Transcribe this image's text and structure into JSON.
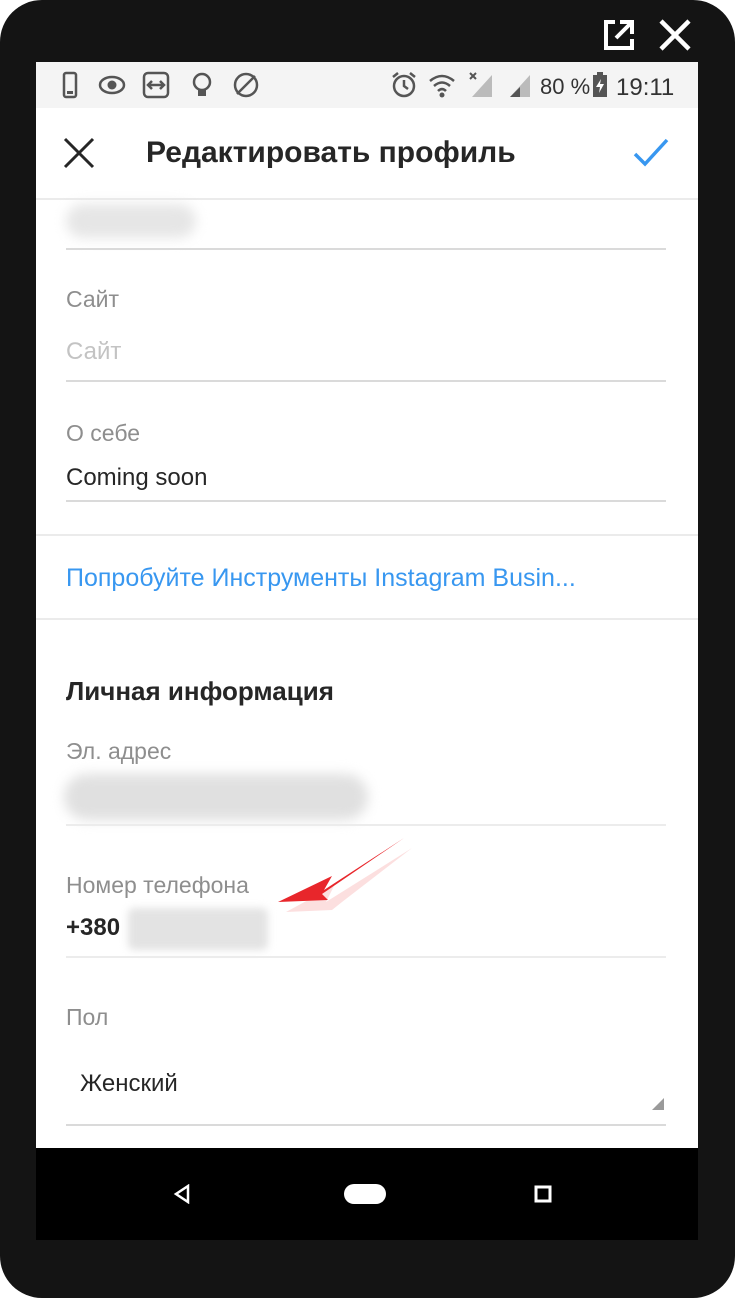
{
  "window_controls": {
    "popout_icon": "external-link-icon",
    "close_icon": "close-icon"
  },
  "statusbar": {
    "battery": "80 %",
    "time": "19:11",
    "left_icons": [
      "phone-icon",
      "eye-icon",
      "teamviewer-icon",
      "bulb-icon",
      "no-data-icon"
    ],
    "right_icons": [
      "alarm-icon",
      "wifi-icon",
      "signal-icon",
      "signal-icon",
      "battery-icon"
    ]
  },
  "header": {
    "title": "Редактировать профиль",
    "close_icon": "close-icon",
    "confirm_icon": "check-icon"
  },
  "form": {
    "website": {
      "label": "Сайт",
      "placeholder": "Сайт"
    },
    "bio": {
      "label": "О себе",
      "value": "Coming soon"
    },
    "business_link": "Попробуйте Инструменты Instagram Busin...",
    "personal_heading": "Личная информация",
    "email": {
      "label": "Эл. адрес"
    },
    "phone": {
      "label": "Номер телефона",
      "value": "+380"
    },
    "gender": {
      "label": "Пол",
      "value": "Женский"
    }
  },
  "navbar": {
    "icons": [
      "back-icon",
      "home-icon",
      "recents-icon"
    ]
  },
  "colors": {
    "accent": "#3897f0",
    "arrow": "#e8262b"
  }
}
